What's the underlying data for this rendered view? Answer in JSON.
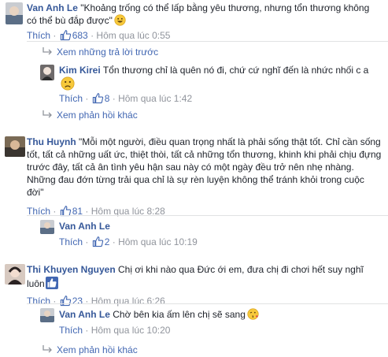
{
  "labels": {
    "like": "Thích",
    "dot": "·"
  },
  "colors": {
    "link": "#4267b2",
    "name": "#365899",
    "meta": "#90949c",
    "text": "#1d2129"
  },
  "comments": [
    {
      "author": "Van Anh Le",
      "text": "\"Khoảng trống có thể lấp bằng yêu thương, nhưng tổn thương không có thể bù đắp được\"",
      "emoji": "grinning-face-emoji",
      "likes": "683",
      "time": "Hôm qua lúc 0:55",
      "view_replies": "Xem những trả lời trước",
      "replies": [
        {
          "author": "Kim Kirei",
          "text": "Tổn thương chỉ là quên nó đi, chứ cứ nghĩ đến là nhức nhối c a",
          "emoji": "frowning-face-emoji",
          "likes": "8",
          "time": "Hôm qua lúc 1:42"
        }
      ],
      "more_replies": "Xem phản hồi khác"
    },
    {
      "author": "Thu Huynh",
      "text": "\"Mỗi một người, điều quan trọng nhất là phải sống thật tốt. Chỉ cần sống tốt, tất cả những uất ức, thiệt thòi, tất cả những tổn thương, khinh khi phải chịu đựng trước đây, tất cả ân tình yêu hận sau này có một ngày đều trở nên nhẹ nhàng. Những đau đớn từng trải qua chỉ là sự rèn luyện không thể tránh khỏi trong cuộc đời\"",
      "likes": "81",
      "time": "Hôm qua lúc 8:28",
      "replies": [
        {
          "author": "Van Anh Le",
          "text": "",
          "likes": "2",
          "time": "Hôm qua lúc 10:19"
        }
      ]
    },
    {
      "author": "Thi Khuyen Nguyen",
      "text": "Chị ơi khi nào qua Đức ới em, đưa chị đi chơi hết suy nghĩ luôn",
      "emoji": "thumbs-up-emoji",
      "likes": "23",
      "time": "Hôm qua lúc 6:26",
      "replies": [
        {
          "author": "Van Anh Le",
          "text": "Chờ bên kia ấm lên chị sẽ sang",
          "emoji": "blowing-kiss-emoji",
          "likes": "",
          "time": "Hôm qua lúc 10:20"
        }
      ],
      "more_replies": "Xem phản hồi khác"
    }
  ]
}
